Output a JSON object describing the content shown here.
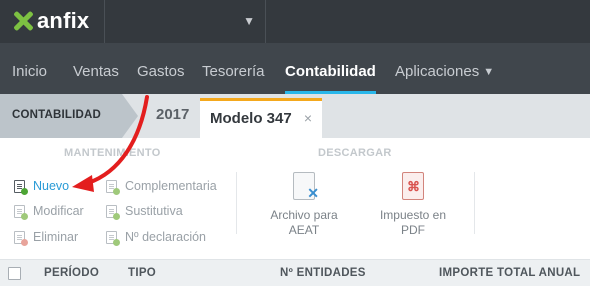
{
  "app": {
    "logo_text": "anfix"
  },
  "nav": {
    "items": [
      "Inicio",
      "Ventas",
      "Gastos",
      "Tesorería",
      "Contabilidad",
      "Aplicaciones"
    ],
    "active": "Contabilidad"
  },
  "breadcrumb": {
    "root": "CONTABILIDAD",
    "year": "2017",
    "tab": "Modelo 347",
    "close_glyph": "×"
  },
  "toolbar": {
    "mantenimiento": {
      "title": "MANTENIMIENTO",
      "items": [
        {
          "label": "Nuevo",
          "enabled": true
        },
        {
          "label": "Modificar",
          "enabled": false
        },
        {
          "label": "Eliminar",
          "enabled": false
        },
        {
          "label": "Complementaria",
          "enabled": false
        },
        {
          "label": "Sustitutiva",
          "enabled": false
        },
        {
          "label": "Nº declaración",
          "enabled": false
        }
      ]
    },
    "descargar": {
      "title": "DESCARGAR",
      "items": [
        {
          "label_line1": "Archivo para",
          "label_line2": "AEAT"
        },
        {
          "label_line1": "Impuesto en",
          "label_line2": "PDF"
        }
      ]
    }
  },
  "table": {
    "columns": [
      "PERÍODO",
      "TIPO",
      "Nº ENTIDADES",
      "IMPORTE TOTAL ANUAL"
    ]
  },
  "colors": {
    "accent": "#29b7ea",
    "brand_green": "#7dc142",
    "tab_highlight": "#f4a81d",
    "annotation_arrow": "#e31e1e"
  }
}
